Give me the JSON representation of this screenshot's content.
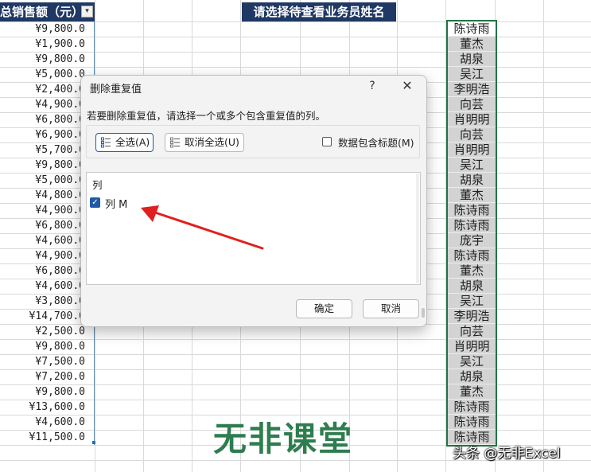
{
  "sheet": {
    "sales_header": "总销售额（元）",
    "filter_glyph": "▾",
    "sales_values": [
      "¥9,800.0",
      "¥1,900.0",
      "¥9,800.0",
      "¥5,000.0",
      "¥2,400.0",
      "¥4,900.0",
      "¥6,800.0",
      "¥6,900.0",
      "¥5,700.0",
      "¥9,800.0",
      "¥5,000.0",
      "¥4,800.0",
      "¥4,900.0",
      "¥6,800.0",
      "¥4,600.0",
      "¥4,900.0",
      "¥6,800.0",
      "¥4,600.0",
      "¥3,800.0",
      "¥14,700.0",
      "¥2,500.0",
      "¥9,800.0",
      "¥7,500.0",
      "¥7,200.0",
      "¥9,800.0",
      "¥13,600.0",
      "¥4,600.0",
      "¥11,500.0"
    ],
    "banner_header": "请选择待查看业务员姓名",
    "names": [
      "陈诗雨",
      "董杰",
      "胡泉",
      "吴江",
      "李明浩",
      "向芸",
      "肖明明",
      "向芸",
      "肖明明",
      "吴江",
      "胡泉",
      "董杰",
      "陈诗雨",
      "陈诗雨",
      "庞宇",
      "陈诗雨",
      "董杰",
      "胡泉",
      "吴江",
      "李明浩",
      "向芸",
      "肖明明",
      "吴江",
      "胡泉",
      "董杰",
      "陈诗雨",
      "陈诗雨",
      "陈诗雨"
    ],
    "selection_color": "#217346",
    "header_color": "#1f3864"
  },
  "dialog": {
    "title": "删除重复值",
    "help": "?",
    "close": "✕",
    "description": "若要删除重复值，请选择一个或多个包含重复值的列。",
    "select_all": "全选(A)",
    "unselect_all": "取消全选(U)",
    "has_headers_label": "数据包含标题(M)",
    "has_headers_checked": false,
    "list_header": "列",
    "columns": [
      {
        "label": "列 M",
        "checked": true
      }
    ],
    "check_glyph": "✓",
    "ok": "确定",
    "cancel": "取消",
    "accent_color": "#1e5aa8"
  },
  "annotation": {
    "arrow_color": "#e02020"
  },
  "logo": {
    "text": "无非课堂",
    "color": "#2e7d4f"
  },
  "watermark": {
    "text": "头条 @无非Excel"
  }
}
